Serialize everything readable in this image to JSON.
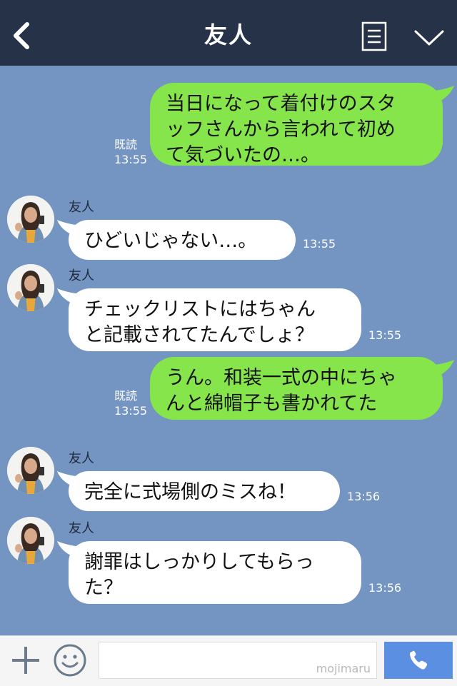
{
  "header": {
    "title": "友人"
  },
  "messages": [
    {
      "type": "out",
      "text": "当日になって着付けのスタッフさんから言われて初めて気づいたの…。",
      "read": "既読",
      "time": "13:55"
    },
    {
      "type": "in",
      "sender": "友人",
      "text": "ひどいじゃない…。",
      "time": "13:55"
    },
    {
      "type": "in",
      "sender": "友人",
      "text": "チェックリストにはちゃんと記載されてたんでしょ？",
      "time": "13:55"
    },
    {
      "type": "out",
      "text": "うん。和装一式の中にちゃんと綿帽子も書かれてた",
      "read": "既読",
      "time": "13:55"
    },
    {
      "type": "in",
      "sender": "友人",
      "text": "完全に式場側のミスね！",
      "time": "13:56"
    },
    {
      "type": "in",
      "sender": "友人",
      "text": "謝罪はしっかりしてもらった？",
      "time": "13:56"
    }
  ],
  "lines": {
    "m0": [
      "当日になって着付けのスタ",
      "ッフさんから言われて初め",
      "て気づいたの…。"
    ],
    "m2": [
      "チェックリストにはちゃん",
      "と記載されてたんでしょ？"
    ],
    "m3": [
      "うん。和装一式の中にちゃ",
      "んと綿帽子も書かれてた"
    ],
    "m5": [
      "謝罪はしっかりしてもらっ",
      "た？"
    ]
  },
  "input": {
    "placeholder": "",
    "watermark": "mojimaru"
  },
  "colors": {
    "background": "#7494c2",
    "header": "#263248",
    "outgoing": "#86e54a",
    "incoming": "#ffffff",
    "call": "#5b8fe2"
  },
  "icons": {
    "back": "chevron-left-icon",
    "menu": "menu-list-icon",
    "collapse": "chevron-down-icon",
    "plus": "plus-icon",
    "emoji": "smiley-icon",
    "call": "phone-icon"
  }
}
